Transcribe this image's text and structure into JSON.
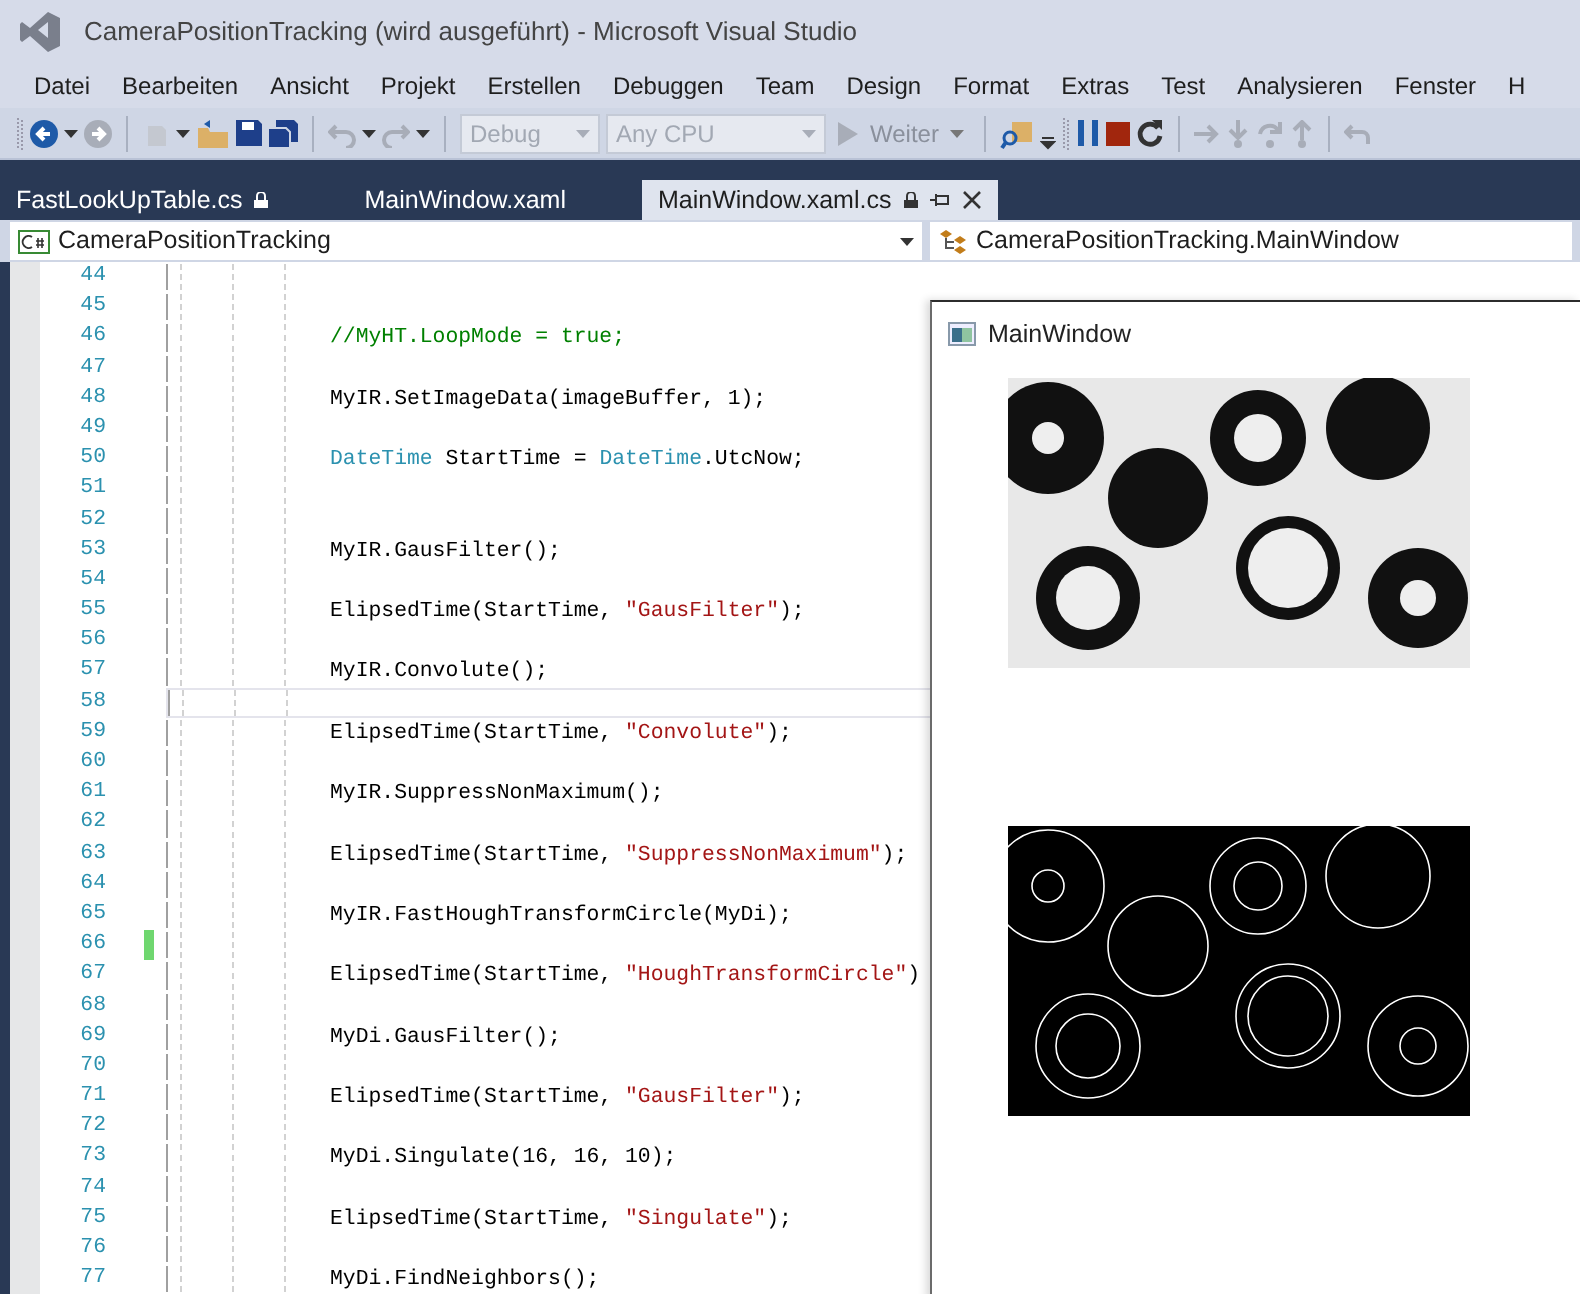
{
  "window": {
    "title": "CameraPositionTracking (wird ausgeführt) - Microsoft Visual Studio"
  },
  "menu": [
    "Datei",
    "Bearbeiten",
    "Ansicht",
    "Projekt",
    "Erstellen",
    "Debuggen",
    "Team",
    "Design",
    "Format",
    "Extras",
    "Test",
    "Analysieren",
    "Fenster",
    "H"
  ],
  "toolbar": {
    "configuration": {
      "value": "Debug",
      "disabled": true
    },
    "platform": {
      "value": "Any CPU",
      "disabled": true
    },
    "continue_button": {
      "label": "Weiter"
    }
  },
  "tabs": [
    {
      "label": "FastLookUpTable.cs",
      "selected": false,
      "locked": true
    },
    {
      "label": "MainWindow.xaml",
      "selected": false,
      "locked": false
    },
    {
      "label": "MainWindow.xaml.cs",
      "selected": true,
      "locked": true
    }
  ],
  "navigation": {
    "project": "CameraPositionTracking",
    "type": "CameraPositionTracking.MainWindow"
  },
  "editor": {
    "lines": [
      {
        "number": "44",
        "current": false,
        "changed": false
      },
      {
        "number": "45",
        "current": false,
        "changed": false
      },
      {
        "number": "46",
        "current": false,
        "changed": false,
        "tokens": [
          {
            "kind": "comment",
            "text": "//MyHT.LoopMode = true;"
          }
        ]
      },
      {
        "number": "47",
        "current": false,
        "changed": false
      },
      {
        "number": "48",
        "current": false,
        "changed": false,
        "tokens": [
          {
            "kind": "plain",
            "text": "MyIR.SetImageData(imageBuffer, 1);"
          }
        ]
      },
      {
        "number": "49",
        "current": false,
        "changed": false
      },
      {
        "number": "50",
        "current": false,
        "changed": false,
        "tokens": [
          {
            "kind": "type",
            "text": "DateTime"
          },
          {
            "kind": "plain",
            "text": " StartTime = "
          },
          {
            "kind": "type",
            "text": "DateTime"
          },
          {
            "kind": "plain",
            "text": ".UtcNow;"
          }
        ]
      },
      {
        "number": "51",
        "current": false,
        "changed": false
      },
      {
        "number": "52",
        "current": false,
        "changed": false
      },
      {
        "number": "53",
        "current": false,
        "changed": false,
        "tokens": [
          {
            "kind": "plain",
            "text": "MyIR.GausFilter();"
          }
        ]
      },
      {
        "number": "54",
        "current": false,
        "changed": false
      },
      {
        "number": "55",
        "current": false,
        "changed": false,
        "tokens": [
          {
            "kind": "plain",
            "text": "ElipsedTime(StartTime, "
          },
          {
            "kind": "string",
            "text": "\"GausFilter\""
          },
          {
            "kind": "plain",
            "text": ");"
          }
        ]
      },
      {
        "number": "56",
        "current": false,
        "changed": false
      },
      {
        "number": "57",
        "current": false,
        "changed": false,
        "tokens": [
          {
            "kind": "plain",
            "text": "MyIR.Convolute();"
          }
        ]
      },
      {
        "number": "58",
        "current": true,
        "changed": false
      },
      {
        "number": "59",
        "current": false,
        "changed": false,
        "tokens": [
          {
            "kind": "plain",
            "text": "ElipsedTime(StartTime, "
          },
          {
            "kind": "string",
            "text": "\"Convolute\""
          },
          {
            "kind": "plain",
            "text": ");"
          }
        ]
      },
      {
        "number": "60",
        "current": false,
        "changed": false
      },
      {
        "number": "61",
        "current": false,
        "changed": false,
        "tokens": [
          {
            "kind": "plain",
            "text": "MyIR.SuppressNonMaximum();"
          }
        ]
      },
      {
        "number": "62",
        "current": false,
        "changed": false
      },
      {
        "number": "63",
        "current": false,
        "changed": false,
        "tokens": [
          {
            "kind": "plain",
            "text": "ElipsedTime(StartTime, "
          },
          {
            "kind": "string",
            "text": "\"SuppressNonMaximum\""
          },
          {
            "kind": "plain",
            "text": ");"
          }
        ]
      },
      {
        "number": "64",
        "current": false,
        "changed": false
      },
      {
        "number": "65",
        "current": false,
        "changed": false,
        "tokens": [
          {
            "kind": "plain",
            "text": "MyIR.FastHoughTransformCircle(MyDi);"
          }
        ]
      },
      {
        "number": "66",
        "current": false,
        "changed": true
      },
      {
        "number": "67",
        "current": false,
        "changed": false,
        "tokens": [
          {
            "kind": "plain",
            "text": "ElipsedTime(StartTime, "
          },
          {
            "kind": "string",
            "text": "\"HoughTransformCircle\""
          },
          {
            "kind": "plain",
            "text": ")"
          }
        ]
      },
      {
        "number": "68",
        "current": false,
        "changed": false
      },
      {
        "number": "69",
        "current": false,
        "changed": false,
        "tokens": [
          {
            "kind": "plain",
            "text": "MyDi.GausFilter();"
          }
        ]
      },
      {
        "number": "70",
        "current": false,
        "changed": false
      },
      {
        "number": "71",
        "current": false,
        "changed": false,
        "tokens": [
          {
            "kind": "plain",
            "text": "ElipsedTime(StartTime, "
          },
          {
            "kind": "string",
            "text": "\"GausFilter\""
          },
          {
            "kind": "plain",
            "text": ");"
          }
        ]
      },
      {
        "number": "72",
        "current": false,
        "changed": false
      },
      {
        "number": "73",
        "current": false,
        "changed": false,
        "tokens": [
          {
            "kind": "plain",
            "text": "MyDi.Singulate(16, 16, 10);"
          }
        ]
      },
      {
        "number": "74",
        "current": false,
        "changed": false
      },
      {
        "number": "75",
        "current": false,
        "changed": false,
        "tokens": [
          {
            "kind": "plain",
            "text": "ElipsedTime(StartTime, "
          },
          {
            "kind": "string",
            "text": "\"Singulate\""
          },
          {
            "kind": "plain",
            "text": ");"
          }
        ]
      },
      {
        "number": "76",
        "current": false,
        "changed": false
      },
      {
        "number": "77",
        "current": false,
        "changed": false,
        "tokens": [
          {
            "kind": "plain",
            "text": "MyDi.FindNeighbors();"
          }
        ]
      }
    ]
  },
  "app_window": {
    "title": "MainWindow"
  }
}
